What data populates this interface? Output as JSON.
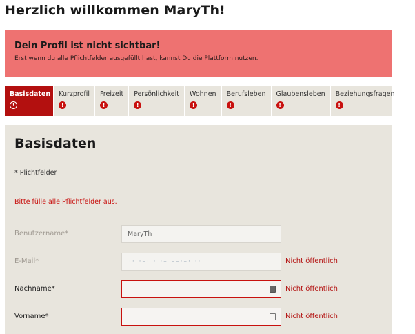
{
  "welcome": "Herzlich willkommen MaryTh!",
  "alert": {
    "title": "Dein Profil ist nicht sichtbar!",
    "text": "Erst wenn du alle Pflichtfelder ausgefüllt hast, kannst Du die Plattform nutzen."
  },
  "tabs": [
    {
      "label": "Basisdaten"
    },
    {
      "label": "Kurzprofil"
    },
    {
      "label": "Freizeit"
    },
    {
      "label": "Persönlichkeit"
    },
    {
      "label": "Wohnen"
    },
    {
      "label": "Berufsleben"
    },
    {
      "label": "Glaubensleben"
    },
    {
      "label": "Beziehungsfragen"
    }
  ],
  "tab_icon": "!",
  "panel": {
    "title": "Basisdaten",
    "required_note": "* Plichtfelder",
    "error_note": "Bitte fülle alle Pflichtfelder aus."
  },
  "form": {
    "username_label": "Benutzername*",
    "username_value": "MaryTh",
    "email_label": "E-Mail*",
    "email_blurred": "·· ·–· ·  ·– ––·–·  ··",
    "lastname_label": "Nachname*",
    "firstname_label": "Vorname*",
    "privacy_label": "Nicht öffentlich"
  },
  "colors": {
    "alert_bg": "#ee7271",
    "accent_red": "#b3100f",
    "panel_bg": "#e8e5dd"
  }
}
